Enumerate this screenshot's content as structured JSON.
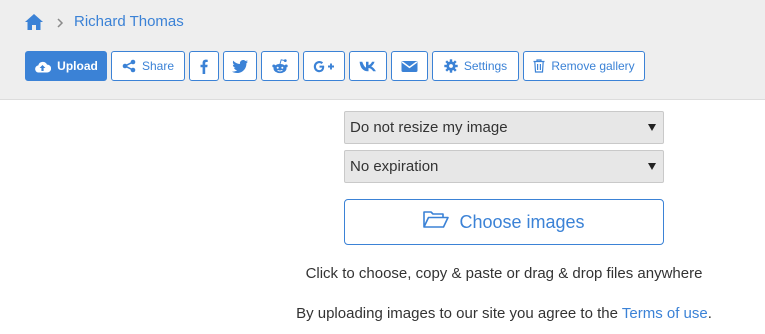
{
  "breadcrumb": {
    "home_icon": "home-icon",
    "current": "Richard Thomas"
  },
  "toolbar": {
    "upload_label": "Upload",
    "share_label": "Share",
    "settings_label": "Settings",
    "remove_gallery_label": "Remove gallery",
    "social_icons": [
      "facebook-icon",
      "twitter-icon",
      "reddit-icon",
      "google-plus-icon",
      "vk-icon",
      "email-icon"
    ]
  },
  "uploader": {
    "resize_selected": "Do not resize my image",
    "expiration_selected": "No expiration",
    "choose_label": "Choose images",
    "hint": "Click to choose, copy & paste or drag & drop files anywhere",
    "terms_prefix": "By uploading images to our site you agree to the ",
    "terms_link": "Terms of use",
    "terms_suffix": "."
  },
  "colors": {
    "accent": "#3b82d6",
    "top_bar_bg": "#eeeeee",
    "select_bg": "#e7e7e7"
  }
}
